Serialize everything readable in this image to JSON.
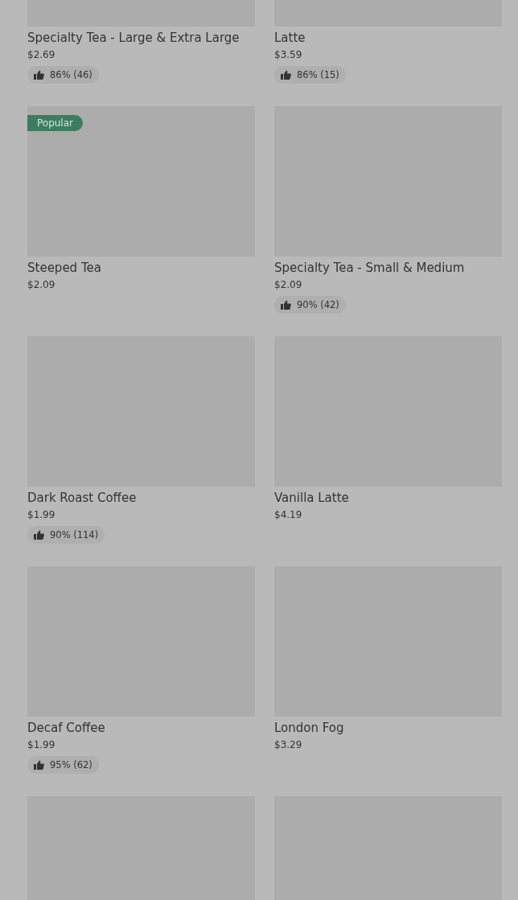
{
  "menu_items": [
    {
      "kind": "product",
      "name": "Specialty Tea - Large & Extra Large",
      "price": "$2.69",
      "rating": "86% (46)"
    },
    {
      "kind": "product",
      "name": "Latte",
      "price": "$3.59",
      "rating": "86% (15)"
    },
    {
      "kind": "product",
      "badge": "Popular",
      "name": "Steeped Tea",
      "price": "$2.09"
    },
    {
      "kind": "product",
      "name": "Specialty Tea - Small & Medium",
      "price": "$2.09",
      "rating": "90% (42)"
    },
    {
      "kind": "product",
      "name": "Dark Roast Coffee",
      "price": "$1.99",
      "rating": "90% (114)"
    },
    {
      "kind": "product",
      "name": "Vanilla Latte",
      "price": "$4.19"
    },
    {
      "kind": "product",
      "name": "Decaf Coffee",
      "price": "$1.99",
      "rating": "95% (62)"
    },
    {
      "kind": "product",
      "name": "London Fog",
      "price": "$3.29"
    },
    {
      "kind": "image_only"
    },
    {
      "kind": "image_only"
    }
  ]
}
